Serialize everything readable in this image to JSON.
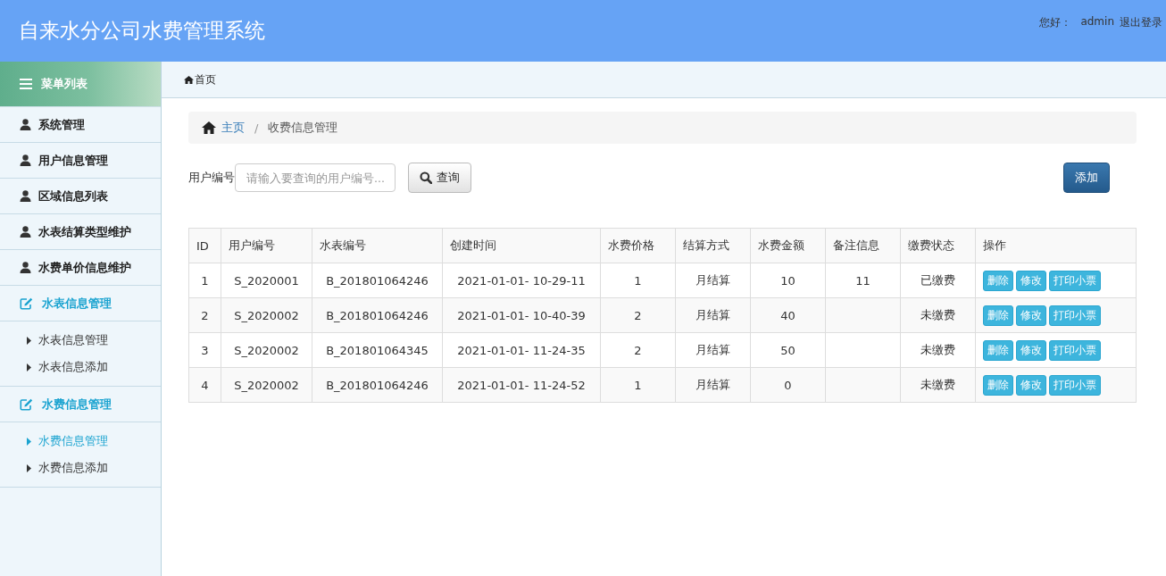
{
  "header": {
    "title": "自来水分公司水费管理系统",
    "greeting": "您好：",
    "user": "admin",
    "logout": "退出登录"
  },
  "sidebar": {
    "title": "菜单列表",
    "items": [
      {
        "kind": "link",
        "label": "系统管理"
      },
      {
        "kind": "link",
        "label": "用户信息管理"
      },
      {
        "kind": "link",
        "label": "区域信息列表"
      },
      {
        "kind": "link",
        "label": "水表结算类型维护"
      },
      {
        "kind": "link",
        "label": "水费单价信息维护"
      },
      {
        "kind": "group",
        "label": "水表信息管理",
        "children": [
          {
            "label": "水表信息管理",
            "selected": false
          },
          {
            "label": "水表信息添加",
            "selected": false
          }
        ]
      },
      {
        "kind": "group",
        "label": "水费信息管理",
        "children": [
          {
            "label": "水费信息管理",
            "selected": true
          },
          {
            "label": "水费信息添加",
            "selected": false
          }
        ]
      }
    ]
  },
  "tab_bar": {
    "label": "首页"
  },
  "breadcrumb": {
    "home": "主页",
    "separator": "/",
    "current": "收费信息管理"
  },
  "search": {
    "label": "用户编号",
    "placeholder": "请输入要查询的用户编号...",
    "button": "查询"
  },
  "add_button": "添加",
  "table": {
    "columns": [
      "ID",
      "用户编号",
      "水表编号",
      "创建时间",
      "水费价格",
      "结算方式",
      "水费金额",
      "备注信息",
      "缴费状态",
      "操作"
    ],
    "rows": [
      {
        "cells": [
          "1",
          "S_2020001",
          "B_201801064246",
          "2021-01-01- 10-29-11",
          "1",
          "月结算",
          "10",
          "11",
          "已缴费"
        ],
        "actions": [
          "删除",
          "修改",
          "打印小票"
        ]
      },
      {
        "cells": [
          "2",
          "S_2020002",
          "B_201801064246",
          "2021-01-01- 10-40-39",
          "2",
          "月结算",
          "40",
          "",
          "未缴费"
        ],
        "actions": [
          "删除",
          "修改",
          "打印小票"
        ]
      },
      {
        "cells": [
          "3",
          "S_2020002",
          "B_201801064345",
          "2021-01-01- 11-24-35",
          "2",
          "月结算",
          "50",
          "",
          "未缴费"
        ],
        "actions": [
          "删除",
          "修改",
          "打印小票"
        ]
      },
      {
        "cells": [
          "4",
          "S_2020002",
          "B_201801064246",
          "2021-01-01- 11-24-52",
          "1",
          "月结算",
          "0",
          "",
          "未缴费"
        ],
        "actions": [
          "删除",
          "修改",
          "打印小票"
        ]
      }
    ]
  }
}
